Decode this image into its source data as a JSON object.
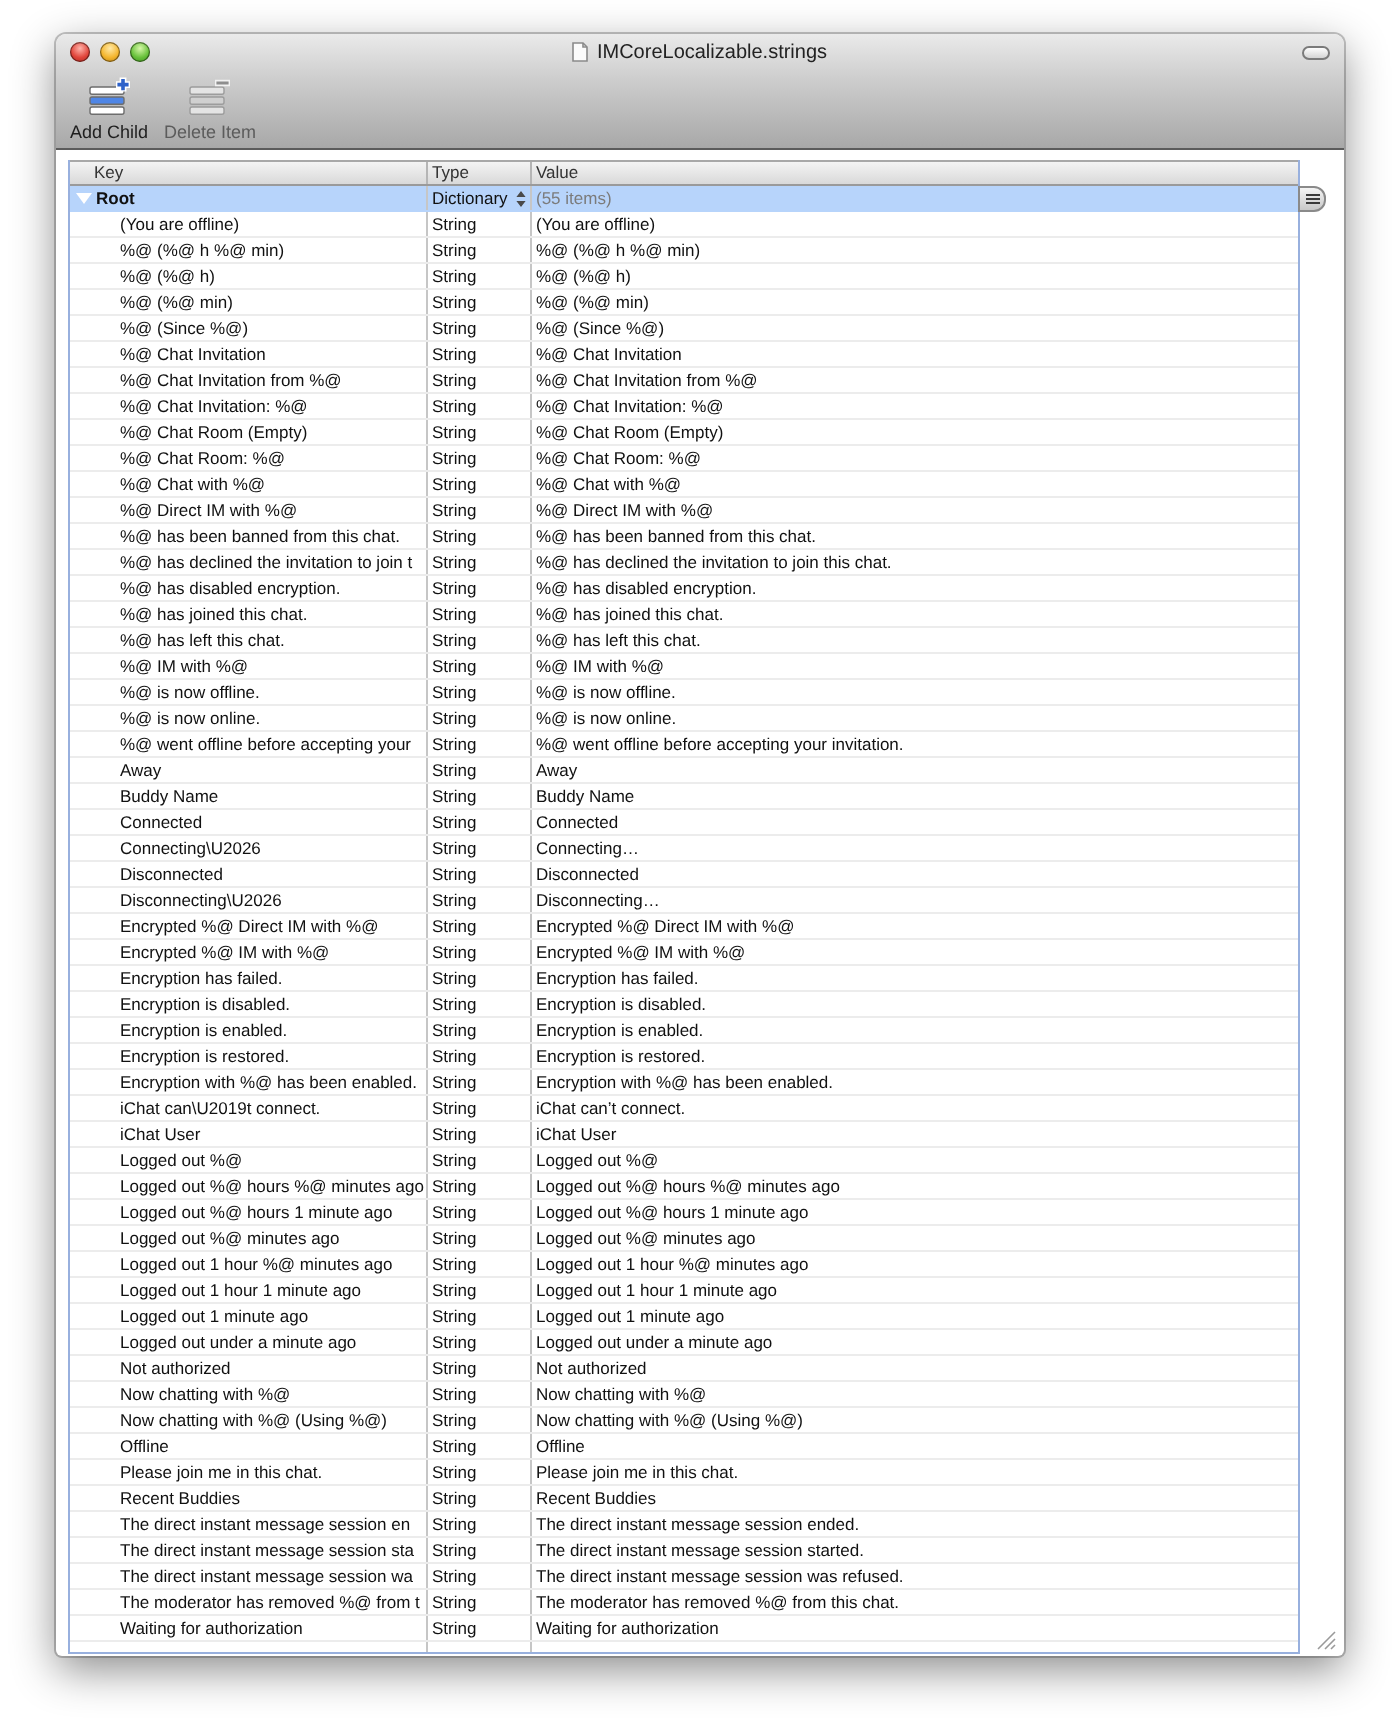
{
  "window": {
    "title": "IMCoreLocalizable.strings"
  },
  "toolbar": [
    {
      "kind": "add",
      "label": "Add Child",
      "disabled": false
    },
    {
      "kind": "delete",
      "label": "Delete Item",
      "disabled": true
    }
  ],
  "table": {
    "columns": [
      "Key",
      "Type",
      "Value"
    ],
    "rows": [
      {
        "key": "Root",
        "type": "Dictionary",
        "value": "(55 items)",
        "selected": true,
        "expanded": true,
        "children": [
          {
            "key": "(You are offline)",
            "type": "String",
            "value": "(You are offline)",
            "selected": false
          },
          {
            "key": "%@ (%@ h %@ min)",
            "type": "String",
            "value": "%@ (%@ h %@ min)",
            "selected": false
          },
          {
            "key": "%@ (%@ h)",
            "type": "String",
            "value": "%@ (%@ h)",
            "selected": false
          },
          {
            "key": "%@ (%@ min)",
            "type": "String",
            "value": "%@ (%@ min)",
            "selected": false
          },
          {
            "key": "%@ (Since %@)",
            "type": "String",
            "value": "%@ (Since %@)",
            "selected": false
          },
          {
            "key": "%@ Chat Invitation",
            "type": "String",
            "value": "%@ Chat Invitation",
            "selected": false
          },
          {
            "key": "%@ Chat Invitation from %@",
            "type": "String",
            "value": "%@ Chat Invitation from %@",
            "selected": false
          },
          {
            "key": "%@ Chat Invitation: %@",
            "type": "String",
            "value": "%@ Chat Invitation: %@",
            "selected": false
          },
          {
            "key": "%@ Chat Room (Empty)",
            "type": "String",
            "value": "%@ Chat Room (Empty)",
            "selected": false
          },
          {
            "key": "%@ Chat Room: %@",
            "type": "String",
            "value": "%@ Chat Room: %@",
            "selected": false
          },
          {
            "key": "%@ Chat with %@",
            "type": "String",
            "value": "%@ Chat with %@",
            "selected": false
          },
          {
            "key": "%@ Direct IM with %@",
            "type": "String",
            "value": "%@ Direct IM with %@",
            "selected": false
          },
          {
            "key": "%@ has been banned from this chat.",
            "type": "String",
            "value": "%@ has been banned from this chat.",
            "selected": false
          },
          {
            "key": "%@ has declined the invitation to join t",
            "type": "String",
            "value": "%@ has declined the invitation to join this chat.",
            "selected": false
          },
          {
            "key": "%@ has disabled encryption.",
            "type": "String",
            "value": "%@ has disabled encryption.",
            "selected": false
          },
          {
            "key": "%@ has joined this chat.",
            "type": "String",
            "value": "%@ has joined this chat.",
            "selected": false
          },
          {
            "key": "%@ has left this chat.",
            "type": "String",
            "value": "%@ has left this chat.",
            "selected": false
          },
          {
            "key": "%@ IM with %@",
            "type": "String",
            "value": "%@ IM with %@",
            "selected": false
          },
          {
            "key": "%@ is now offline.",
            "type": "String",
            "value": "%@ is now offline.",
            "selected": false
          },
          {
            "key": "%@ is now online.",
            "type": "String",
            "value": "%@ is now online.",
            "selected": false
          },
          {
            "key": "%@ went offline before accepting your",
            "type": "String",
            "value": "%@ went offline before accepting your invitation.",
            "selected": false
          },
          {
            "key": "Away",
            "type": "String",
            "value": "Away",
            "selected": false
          },
          {
            "key": "Buddy Name",
            "type": "String",
            "value": "Buddy Name",
            "selected": false
          },
          {
            "key": "Connected",
            "type": "String",
            "value": "Connected",
            "selected": false
          },
          {
            "key": "Connecting\\U2026",
            "type": "String",
            "value": "Connecting…",
            "selected": false
          },
          {
            "key": "Disconnected",
            "type": "String",
            "value": "Disconnected",
            "selected": false
          },
          {
            "key": "Disconnecting\\U2026",
            "type": "String",
            "value": "Disconnecting…",
            "selected": false
          },
          {
            "key": "Encrypted %@ Direct IM with %@",
            "type": "String",
            "value": "Encrypted %@ Direct IM with %@",
            "selected": false
          },
          {
            "key": "Encrypted %@ IM with %@",
            "type": "String",
            "value": "Encrypted %@ IM with %@",
            "selected": false
          },
          {
            "key": "Encryption has failed.",
            "type": "String",
            "value": "Encryption has failed.",
            "selected": false
          },
          {
            "key": "Encryption is disabled.",
            "type": "String",
            "value": "Encryption is disabled.",
            "selected": false
          },
          {
            "key": "Encryption is enabled.",
            "type": "String",
            "value": "Encryption is enabled.",
            "selected": false
          },
          {
            "key": "Encryption is restored.",
            "type": "String",
            "value": "Encryption is restored.",
            "selected": false
          },
          {
            "key": "Encryption with %@ has been enabled.",
            "type": "String",
            "value": "Encryption with %@ has been enabled.",
            "selected": false
          },
          {
            "key": "iChat can\\U2019t connect.",
            "type": "String",
            "value": "iChat can’t connect.",
            "selected": false
          },
          {
            "key": "iChat User",
            "type": "String",
            "value": "iChat User",
            "selected": false
          },
          {
            "key": "Logged out %@",
            "type": "String",
            "value": "Logged out %@",
            "selected": false
          },
          {
            "key": "Logged out %@ hours %@ minutes ago",
            "type": "String",
            "value": "Logged out %@ hours %@ minutes ago",
            "selected": false
          },
          {
            "key": "Logged out %@ hours 1 minute ago",
            "type": "String",
            "value": "Logged out %@ hours 1 minute ago",
            "selected": false
          },
          {
            "key": "Logged out %@ minutes ago",
            "type": "String",
            "value": "Logged out %@ minutes ago",
            "selected": false
          },
          {
            "key": "Logged out 1 hour %@ minutes ago",
            "type": "String",
            "value": "Logged out 1 hour %@ minutes ago",
            "selected": false
          },
          {
            "key": "Logged out 1 hour 1 minute ago",
            "type": "String",
            "value": "Logged out 1 hour 1 minute ago",
            "selected": false
          },
          {
            "key": "Logged out 1 minute ago",
            "type": "String",
            "value": "Logged out 1 minute ago",
            "selected": false
          },
          {
            "key": "Logged out under a minute ago",
            "type": "String",
            "value": "Logged out under a minute ago",
            "selected": false
          },
          {
            "key": "Not authorized",
            "type": "String",
            "value": "Not authorized",
            "selected": false
          },
          {
            "key": "Now chatting with %@",
            "type": "String",
            "value": "Now chatting with %@",
            "selected": false
          },
          {
            "key": "Now chatting with %@ (Using %@)",
            "type": "String",
            "value": "Now chatting with %@ (Using %@)",
            "selected": false
          },
          {
            "key": "Offline",
            "type": "String",
            "value": "Offline",
            "selected": false
          },
          {
            "key": "Please join me in this chat.",
            "type": "String",
            "value": "Please join me in this chat.",
            "selected": false
          },
          {
            "key": "Recent Buddies",
            "type": "String",
            "value": "Recent Buddies",
            "selected": false
          },
          {
            "key": "The direct instant message session en",
            "type": "String",
            "value": "The direct instant message session ended.",
            "selected": false
          },
          {
            "key": "The direct instant message session sta",
            "type": "String",
            "value": "The direct instant message session started.",
            "selected": false
          },
          {
            "key": "The direct instant message session wa",
            "type": "String",
            "value": "The direct instant message session was refused.",
            "selected": false
          },
          {
            "key": "The moderator has removed %@ from t",
            "type": "String",
            "value": "The moderator has removed %@ from this chat.",
            "selected": false
          },
          {
            "key": "Waiting for authorization",
            "type": "String",
            "value": "Waiting for authorization",
            "selected": false
          }
        ]
      }
    ]
  }
}
